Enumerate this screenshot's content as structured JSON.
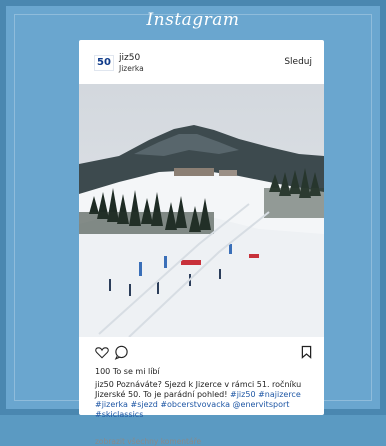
{
  "brand": {
    "logo_text": "Instagram"
  },
  "post": {
    "user": {
      "username": "jiz50",
      "location": "Jizerka",
      "avatar_text": "50"
    },
    "follow_label": "Sleduj",
    "likes": "100 To se mi líbí",
    "caption": {
      "text": "jiz50 Poznáváte? Sjezd k Jizerce v rámci 51. ročníku Jizerské 50. To je parádní pohled!",
      "hashtags": "#jiz50 #najizerce #jizerka #sjezd #obcerstvovacka @enervitsport #skiclassics"
    },
    "comments_link": "zobrazit všechny komentáře"
  },
  "icons": [
    "heart-icon",
    "comment-icon",
    "bookmark-icon"
  ],
  "colors": {
    "background": "#5b9ac2",
    "hashtag": "#1f57a5"
  }
}
